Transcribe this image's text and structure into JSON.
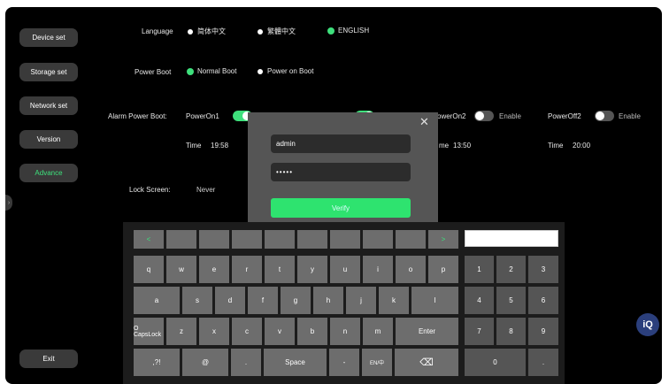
{
  "sidebar": {
    "items": [
      {
        "label": "Device set"
      },
      {
        "label": "Storage set"
      },
      {
        "label": "Network set"
      },
      {
        "label": "Version"
      },
      {
        "label": "Advance"
      }
    ],
    "exit_label": "Exit",
    "active_item": "Advance",
    "accent_color": "#3ee07c"
  },
  "language": {
    "label": "Language",
    "options": [
      "简体中文",
      "繁體中文",
      "ENGLISH"
    ],
    "selected": "ENGLISH"
  },
  "power_boot": {
    "label": "Power Boot",
    "options": [
      "Normal Boot",
      "Power on Boot"
    ],
    "selected": "Normal Boot"
  },
  "alarm_power_boot": {
    "label": "Alarm Power Boot:",
    "poweron1": {
      "label": "PowerOn1",
      "enabled": true
    },
    "poweroff1": {
      "enabled": true
    },
    "poweron2": {
      "label": "owerOn2",
      "enable_label": "Enable",
      "enabled": false
    },
    "poweroff2": {
      "label": "PowerOff2",
      "enable_label": "Enable",
      "enabled": false
    },
    "time_label": "Time",
    "time_on1": "19:58",
    "time_on2_label": "me",
    "time_on2": "13:50",
    "time_off2_label": "Time",
    "time_off2": "20:00"
  },
  "lock_screen": {
    "label": "Lock Screen:",
    "value": "Never"
  },
  "dialog": {
    "username": "admin",
    "password_masked": "•••••",
    "verify_label": "Verify",
    "close_icon": "close-icon"
  },
  "keyboard": {
    "nav_left": "<",
    "nav_right": ">",
    "row1": [
      "q",
      "w",
      "e",
      "r",
      "t",
      "y",
      "u",
      "i",
      "o",
      "p"
    ],
    "row2": [
      "a",
      "s",
      "d",
      "f",
      "g",
      "h",
      "j",
      "k",
      "l"
    ],
    "row3": [
      "O CapsLock",
      "z",
      "x",
      "c",
      "v",
      "b",
      "n",
      "m",
      "Enter"
    ],
    "row4": [
      ",?!",
      "@",
      ".",
      "Space",
      "-",
      "EN/中",
      "backspace-icon"
    ],
    "num1": [
      "1",
      "2",
      "3"
    ],
    "num2": [
      "4",
      "5",
      "6"
    ],
    "num3": [
      "7",
      "8",
      "9"
    ],
    "num4": [
      "0",
      "."
    ],
    "backspace_glyph": "⌫",
    "lang_glyph": "EN/中"
  },
  "iq_badge": "iQ",
  "edge_tab_glyph": "›"
}
